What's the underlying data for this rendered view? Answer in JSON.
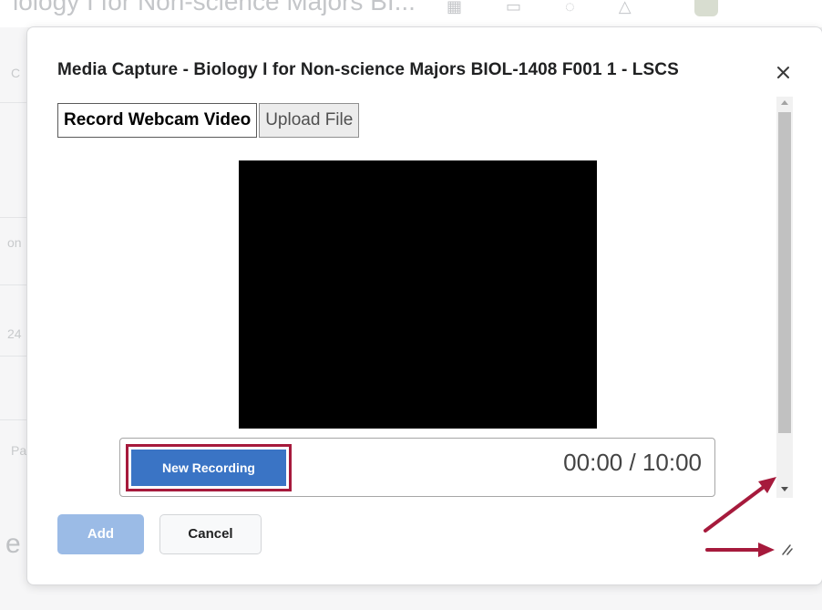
{
  "background": {
    "course_title": "iology I for Non-science Majors BI...",
    "fragments": [
      "C",
      "on",
      "24",
      "Pa",
      "e"
    ]
  },
  "dialog": {
    "title": "Media Capture - Biology I for Non-science Majors BIOL-1408 F001 1 - LSCS",
    "close_icon": "close-icon"
  },
  "tabs": [
    {
      "label": "Record Webcam Video",
      "active": true
    },
    {
      "label": "Upload File",
      "active": false
    }
  ],
  "recorder": {
    "new_recording_label": "New Recording",
    "elapsed": "00:00",
    "separator": " / ",
    "max_duration": "10:00"
  },
  "footer": {
    "add_label": "Add",
    "cancel_label": "Cancel"
  },
  "colors": {
    "primary_button": "#3a74c5",
    "disabled_primary": "#9bbbe6",
    "annotation": "#a61a3c",
    "video_bg": "#000000"
  }
}
